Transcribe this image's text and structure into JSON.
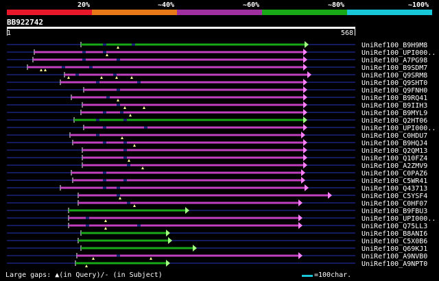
{
  "scale": {
    "labels": [
      "20%",
      "~40%",
      "~60%",
      "~80%",
      "~100%"
    ],
    "colors": [
      "#e8182a",
      "#e87818",
      "#a030a0",
      "#18a818",
      "#18c8d8"
    ]
  },
  "query": {
    "id": "BB922742",
    "start": "1",
    "end": "568"
  },
  "colors": {
    "purple": "#c040c0",
    "green": "#18a818",
    "dark_line": "#1a237e",
    "triangle": "#ffff99",
    "end_marker": "#ff80ff",
    "end_marker_green": "#a0ff80"
  },
  "hits": [
    {
      "name": "UniRef100_B9H9M8",
      "color": "green"
    },
    {
      "name": "UniRef100_UPI000..",
      "color": "purple"
    },
    {
      "name": "UniRef100_A7PG98",
      "color": "purple"
    },
    {
      "name": "UniRef100_B9SDM7",
      "color": "purple"
    },
    {
      "name": "UniRef100_Q9SRM8",
      "color": "purple"
    },
    {
      "name": "UniRef100_Q9SHT0",
      "color": "purple"
    },
    {
      "name": "UniRef100_Q9FNH0",
      "color": "purple"
    },
    {
      "name": "UniRef100_B9RQ41",
      "color": "purple"
    },
    {
      "name": "UniRef100_B9IIH3",
      "color": "purple"
    },
    {
      "name": "UniRef100_B9MYL9",
      "color": "purple"
    },
    {
      "name": "UniRef100_Q2HT06",
      "color": "green"
    },
    {
      "name": "UniRef100_UPI000..",
      "color": "purple"
    },
    {
      "name": "UniRef100_C0HDU7",
      "color": "purple"
    },
    {
      "name": "UniRef100_B9HQJ4",
      "color": "purple"
    },
    {
      "name": "UniRef100_Q2QM13",
      "color": "purple"
    },
    {
      "name": "UniRef100_Q10FZ4",
      "color": "purple"
    },
    {
      "name": "UniRef100_A2ZMV9",
      "color": "purple"
    },
    {
      "name": "UniRef100_C0PAZ6",
      "color": "purple"
    },
    {
      "name": "UniRef100_C5WR41",
      "color": "purple"
    },
    {
      "name": "UniRef100_Q43713",
      "color": "purple"
    },
    {
      "name": "UniRef100_C5YSF4",
      "color": "purple"
    },
    {
      "name": "UniRef100_C0HF07",
      "color": "purple"
    },
    {
      "name": "UniRef100_B9FBU3",
      "color": "green"
    },
    {
      "name": "UniRef100_UPI000..",
      "color": "purple"
    },
    {
      "name": "UniRef100_Q75LL3",
      "color": "purple"
    },
    {
      "name": "UniRef100_B8ANI6",
      "color": "green"
    },
    {
      "name": "UniRef100_C5X0B6",
      "color": "green"
    },
    {
      "name": "UniRef100_Q69KJ1",
      "color": "green"
    },
    {
      "name": "UniRef100_A9NVB0",
      "color": "purple"
    },
    {
      "name": "UniRef100_A9NPT0",
      "color": "green"
    }
  ],
  "legend": {
    "gaps_text": "Large gaps: ▲(in Query)/- (in Subject)",
    "scale_text": "=100char."
  }
}
